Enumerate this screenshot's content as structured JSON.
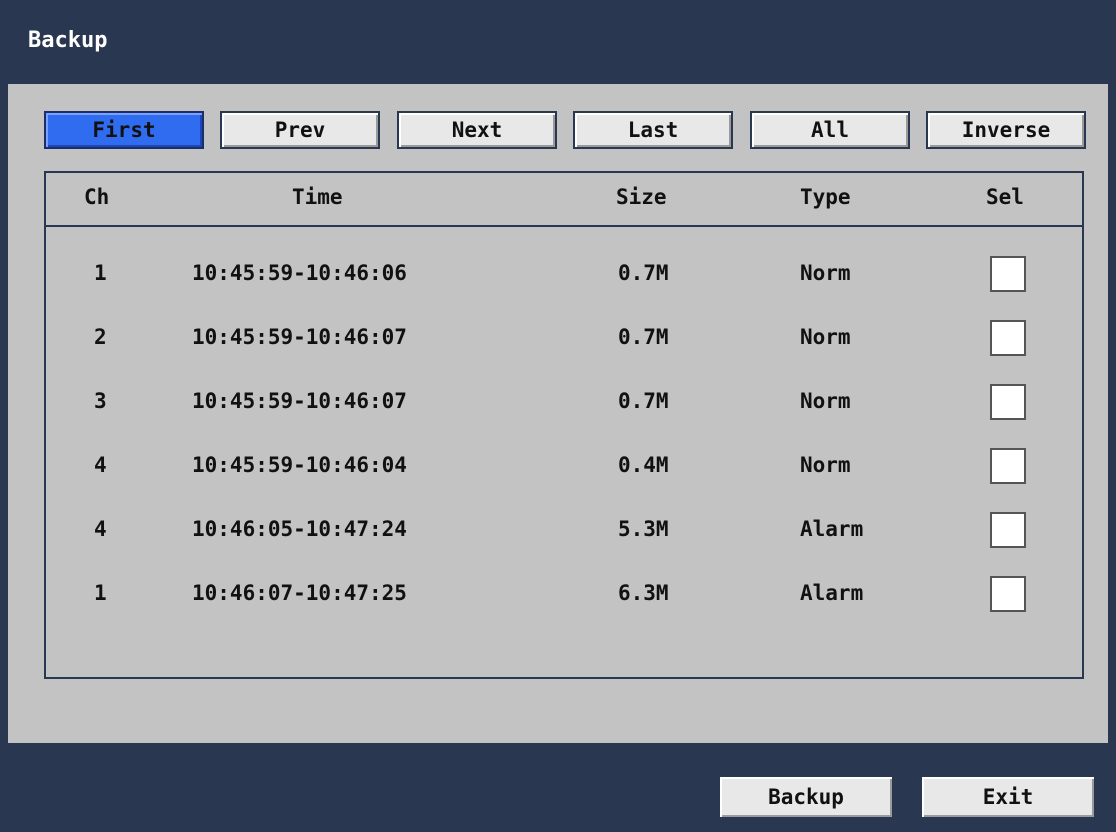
{
  "window": {
    "title": "Backup"
  },
  "nav_buttons": [
    {
      "label": "First",
      "active": true
    },
    {
      "label": "Prev",
      "active": false
    },
    {
      "label": "Next",
      "active": false
    },
    {
      "label": "Last",
      "active": false
    },
    {
      "label": "All",
      "active": false
    },
    {
      "label": "Inverse",
      "active": false
    }
  ],
  "table": {
    "columns": [
      "Ch",
      "Time",
      "Size",
      "Type",
      "Sel"
    ],
    "rows": [
      {
        "ch": "1",
        "time": "10:45:59-10:46:06",
        "size": "0.7M",
        "type": "Norm",
        "selected": false
      },
      {
        "ch": "2",
        "time": "10:45:59-10:46:07",
        "size": "0.7M",
        "type": "Norm",
        "selected": false
      },
      {
        "ch": "3",
        "time": "10:45:59-10:46:07",
        "size": "0.7M",
        "type": "Norm",
        "selected": false
      },
      {
        "ch": "4",
        "time": "10:45:59-10:46:04",
        "size": "0.4M",
        "type": "Norm",
        "selected": false
      },
      {
        "ch": "4",
        "time": "10:46:05-10:47:24",
        "size": "5.3M",
        "type": "Alarm",
        "selected": false
      },
      {
        "ch": "1",
        "time": "10:46:07-10:47:25",
        "size": "6.3M",
        "type": "Alarm",
        "selected": false
      }
    ]
  },
  "footer": {
    "backup_label": "Backup",
    "exit_label": "Exit"
  },
  "colors": {
    "frame": "#2a3751",
    "panel": "#c3c3c3",
    "active_button": "#2f6cf0"
  }
}
